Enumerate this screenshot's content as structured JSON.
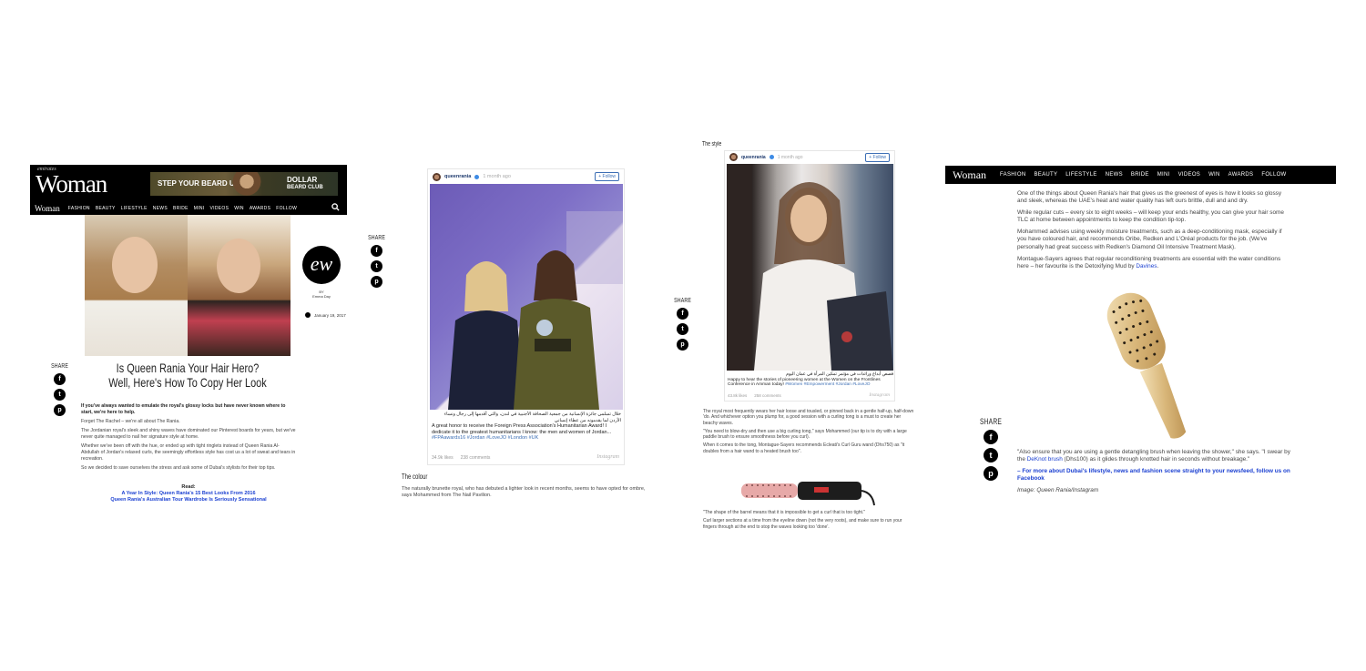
{
  "panel1": {
    "logo_top": "emirates",
    "logo": "Woman",
    "ad": {
      "left_text": "STEP YOUR BEARD UP",
      "right_text_1": "DOLLAR",
      "right_text_2": "BEARD CLUB"
    },
    "nav_logo": "Woman",
    "nav": [
      "FASHION",
      "BEAUTY",
      "LIFESTYLE",
      "NEWS",
      "BRIDE",
      "MINI",
      "VIDEOS",
      "WIN",
      "AWARDS",
      "FOLLOW"
    ],
    "title": "Is Queen Rania Your Hair Hero? Well, Here's How To Copy Her Look",
    "author_logo": "ew",
    "by_label": "BY",
    "author": "Emma Day",
    "date": "January 19, 2017",
    "share": {
      "label": "SHARE",
      "icons": [
        "f",
        "t",
        "p"
      ]
    },
    "body": [
      "If you've always wanted to emulate the royal's glossy locks but have never known where to start, we're here to help.",
      "Forget The Rachel – we're all about The Rania.",
      "The Jordanian royal's sleek and shiny waves have dominated our Pinterest boards for years, but we've never quite managed to nail her signature style at home.",
      "Whether we've been off with the hue, or ended up with tight ringlets instead of Queen Rania Al-Abdullah of Jordan's relaxed curls, the seemingly effortless style has cost us a lot of sweat and tears in recreation.",
      "So we decided to save ourselves the stress and ask some of Dubai's stylists for their top tips."
    ],
    "read_label": "Read:",
    "read_links": [
      "A Year In Style: Queen Rania's 15 Best Looks From 2016",
      "Queen Rania's Australian Tour Wardrobe Is Seriously Sensational"
    ]
  },
  "panel2": {
    "ig": {
      "user": "queenrania",
      "time": "1 month ago",
      "follow": "+ Follow"
    },
    "caption_ar": "خلال تسلمي جائزة الإنسانية من جمعية الصحافة الأجنبية في لندن، والتي أقدمها إلى رجال ونساء الأردن لما يقدمونه من عطاء إنساني",
    "caption": "A great honor to receive the Foreign Press Association's Humanitarian Award! I dedicate it to the greatest humanitarians I know: the men and women of Jordan...",
    "caption_tags": "#FPAawards16 #Jordan #LoveJO #London #UK",
    "likes": "34.9k likes",
    "comments": "238 comments",
    "ig_brand": "Instagram",
    "section_title": "The colour",
    "section_text": "The naturally brunette royal, who has debuted a lighter look in recent months, seems to have opted for ombre, says Mohammed from The Nail Pavilion."
  },
  "panel3": {
    "section_title": "The style",
    "ig": {
      "user": "queenrania",
      "time": "1 month ago",
      "follow": "+ Follow"
    },
    "caption_ar": "قصص أبداع ورائدات في مؤتمر تمكين المرأة في عمان اليوم",
    "caption": "Happy to hear the stories of pioneering women at the Women on the Frontlines Conference in Amman today!",
    "caption_tags": "#Women #Empowerment #Jordan #LoveJO",
    "likes": "43.8k likes",
    "comments": "258 comments",
    "ig_brand": "Instagram",
    "share": {
      "label": "SHARE",
      "icons": [
        "f",
        "t",
        "p"
      ]
    },
    "text1": [
      "The royal most frequently wears her hair loose and tousled, or pinned back in a gentle half-up, half-down 'do. And whichever option you plump for, a good session with a curling tong is a must to create her beachy waves.",
      "\"You need to blow-dry and then use a big curling tong,\" says Mohammed (our tip is to dry with a large paddle brush to ensure smoothness before you curl).",
      "When it comes to the tong, Montague-Sayers recommends Ecleati's Curl Guru wand (Dhs750) as \"it doubles from a hair wand to a heated brush too\"."
    ],
    "text2": [
      "\"The shape of the barrel means that it is impossible to get a curl that is too tight.\"",
      "Curl larger sections at a time from the eyeline down (not the very roots), and make sure to run your fingers through at the end to stop the waves looking too 'done'."
    ]
  },
  "panel4": {
    "nav_logo": "Woman",
    "nav": [
      "FASHION",
      "BEAUTY",
      "LIFESTYLE",
      "NEWS",
      "BRIDE",
      "MINI",
      "VIDEOS",
      "WIN",
      "AWARDS",
      "FOLLOW"
    ],
    "text1": [
      "One of the things about Queen Rania's hair that gives us the greenest of eyes is how it looks so glossy and sleek, whereas the UAE's heat and water quality has left ours brittle, dull and and dry.",
      "While regular cuts – every six to eight weeks – will keep your ends healthy, you can give your hair some TLC at home between appointments to keep the condition tip-top.",
      "Mohammed advises using weekly moisture treatments, such as a deep-conditioning mask, especially if you have coloured hair, and recommends Oribe, Redken and L'Oréal products for the job. (We've personally had great success with Redken's Diamond Oil Intensive Treatment Mask)."
    ],
    "p4_pre": "Montague-Sayers agrees that regular reconditioning treatments are essential with the water conditions here – her favourite is the Detoxifying Mud by ",
    "p4_link": "Davines",
    "p4_post": ".",
    "share": {
      "label": "SHARE",
      "icons": [
        "f",
        "t",
        "p"
      ]
    },
    "quote_pre": "\"Also ensure that you are using a gentle detangling brush when leaving the shower,\" she says. \"I swear by the ",
    "quote_link": "DeKnot brush",
    "quote_post": " (Dhs100) as it glides through knotted hair in seconds without breakage.\"",
    "follow_text": "– For more about Dubai's lifestyle, news and fashion scene straight to your newsfeed, follow us on Facebook",
    "credit": "Image: Queen Rania/Instagram"
  }
}
